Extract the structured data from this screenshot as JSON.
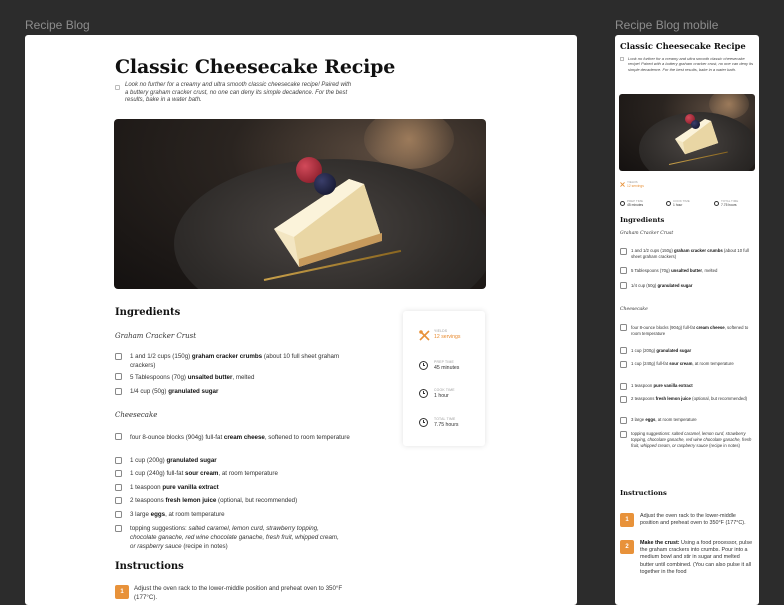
{
  "frames": {
    "desktop_label": "Recipe Blog",
    "mobile_label": "Recipe Blog mobile"
  },
  "recipe": {
    "title": "Classic Cheesecake Recipe",
    "intro": "Look no further for a creamy and ultra smooth classic cheesecake recipe! Paired with a buttery graham cracker crust, no one can deny its simple decadence. For the best results, bake in a water bath.",
    "hero_image": "cheesecake-slice-photo",
    "accent_color": "#e8923a"
  },
  "stats": {
    "yields_label": "YIELDS",
    "yields_value": "12 servings",
    "prep_label": "PREP TIME",
    "prep_value": "45 minutes",
    "cook_label": "COOK TIME",
    "cook_value": "1 hour",
    "total_label": "TOTAL TIME",
    "total_value": "7.75 hours"
  },
  "ingredients": {
    "heading": "Ingredients",
    "crust_heading": "Graham Cracker Crust",
    "crust": [
      {
        "pre": "1 and 1/2 cups (150g) ",
        "bold": "graham cracker crumbs",
        "post": " (about 10 full sheet graham crackers)"
      },
      {
        "pre": "5 Tablespoons (70g) ",
        "bold": "unsalted butter",
        "post": ", melted"
      },
      {
        "pre": "1/4 cup (50g) ",
        "bold": "granulated sugar",
        "post": ""
      }
    ],
    "cheesecake_heading": "Cheesecake",
    "cheesecake": [
      {
        "pre": "four 8-ounce blocks (904g) full-fat ",
        "bold": "cream cheese",
        "post": ", softened to room temperature"
      },
      {
        "pre": "1 cup (200g) ",
        "bold": "granulated sugar",
        "post": ""
      },
      {
        "pre": "1 cup (240g) full-fat ",
        "bold": "sour cream",
        "post": ", at room temperature"
      },
      {
        "pre": "1 teaspoon ",
        "bold": "pure vanilla extract",
        "post": ""
      },
      {
        "pre": "2 teaspoons ",
        "bold": "fresh lemon juice",
        "post": " (optional, but recommended)"
      },
      {
        "pre": "3 large ",
        "bold": "eggs",
        "post": ", at room temperature"
      },
      {
        "pre": "topping suggestions: ",
        "bold": "",
        "italic": "salted caramel, lemon curd, strawberry topping, chocolate ganache, red wine chocolate ganache, fresh fruit, whipped cream, or raspberry sauce",
        "post": " (recipe in notes)"
      }
    ]
  },
  "instructions": {
    "heading": "Instructions",
    "steps": [
      {
        "num": "1",
        "bold": "",
        "text": "Adjust the oven rack to the lower-middle position and preheat oven to 350°F (177°C)."
      },
      {
        "num": "2",
        "bold": "Make the crust:",
        "text": " Using a food processor, pulse the graham crackers into crumbs. Pour into a medium bowl and stir in sugar and melted butter until combined. (You can also pulse it all together in the food"
      }
    ]
  }
}
